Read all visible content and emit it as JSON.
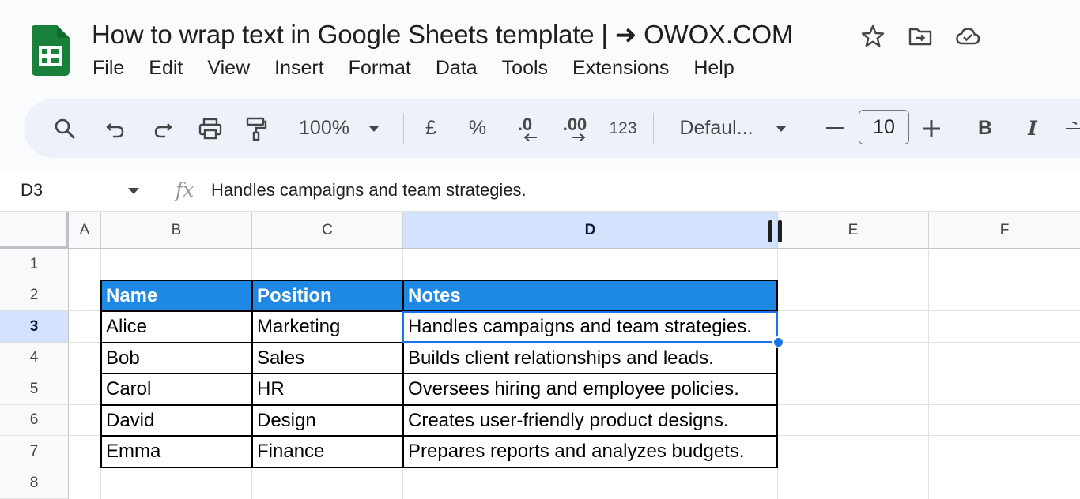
{
  "document": {
    "title": "How to wrap text in Google Sheets template | ➜ OWOX.COM"
  },
  "menu": [
    "File",
    "Edit",
    "View",
    "Insert",
    "Format",
    "Data",
    "Tools",
    "Extensions",
    "Help"
  ],
  "toolbar": {
    "zoom": "100%",
    "currency": "£",
    "percent": "%",
    "decrease_decimal": ".0",
    "increase_decimal": ".00",
    "number_format": "123",
    "font": "Defaul...",
    "font_size": "10",
    "bold": "B",
    "italic": "I"
  },
  "formula_bar": {
    "cell_ref": "D3",
    "fx": "fx",
    "value": "Handles campaigns and team strategies."
  },
  "columns": [
    "A",
    "B",
    "C",
    "D",
    "E",
    "F"
  ],
  "selected_column": "D",
  "rows": [
    "1",
    "2",
    "3",
    "4",
    "5",
    "6",
    "7",
    "8"
  ],
  "selected_row": "3",
  "table": {
    "headers": [
      "Name",
      "Position",
      "Notes"
    ],
    "rows": [
      [
        "Alice",
        "Marketing",
        "Handles campaigns and team strategies."
      ],
      [
        "Bob",
        "Sales",
        "Builds client relationships and leads."
      ],
      [
        "Carol",
        "HR",
        "Oversees hiring and employee policies."
      ],
      [
        "David",
        "Design",
        "Creates user-friendly product designs."
      ],
      [
        "Emma",
        "Finance",
        "Prepares reports and analyzes budgets."
      ]
    ]
  },
  "colors": {
    "header_fill": "#1e88e5",
    "selection": "#1a73e8",
    "sheets_green": "#188038",
    "toolbar_bg": "#edf2fa"
  },
  "icons": [
    "sheets-logo-icon",
    "star-icon",
    "move-folder-icon",
    "cloud-saved-icon",
    "search-icon",
    "undo-icon",
    "redo-icon",
    "print-icon",
    "paint-format-icon",
    "dropdown-caret-icon",
    "minus-icon",
    "plus-icon",
    "fx-icon",
    "column-resize-handle-icon"
  ]
}
